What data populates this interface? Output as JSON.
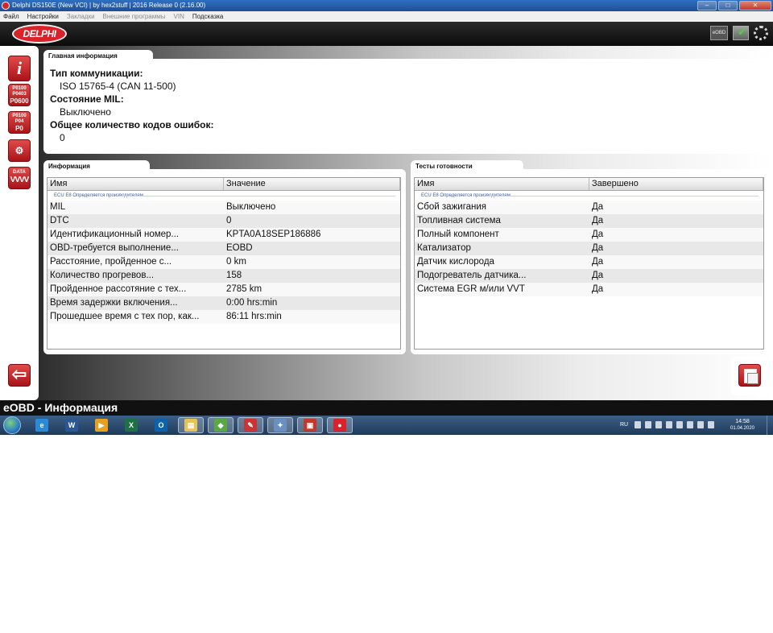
{
  "window": {
    "title": "Delphi DS150E (New VCI) | by hex2stuff | 2016 Release 0 (2.16.00)"
  },
  "menu": [
    {
      "label": "Файл",
      "enabled": true
    },
    {
      "label": "Настройки",
      "enabled": true
    },
    {
      "label": "Закладки",
      "enabled": false
    },
    {
      "label": "Внешние программы",
      "enabled": false
    },
    {
      "label": "VIN",
      "enabled": false
    },
    {
      "label": "Подсказка",
      "enabled": true
    }
  ],
  "header": {
    "logo_text": "DELPHI",
    "eobd_badge": "eOBD",
    "icons": [
      "eobd-icon",
      "flag-check-icon",
      "busy-spinner-icon"
    ]
  },
  "sidebar": {
    "info_glyph": "i",
    "codes_btn": [
      "P0100",
      "P0403",
      "P0600"
    ],
    "codes_clear_btn": [
      "P0100",
      "P04",
      "P0"
    ],
    "data_label": "DATA",
    "data_wave": "VVVV",
    "back_glyph": "⇦"
  },
  "main_info": {
    "tab": "Главная информация",
    "fields": [
      {
        "label": "Тип коммуникации:",
        "value": "ISO 15765-4 (CAN 11-500)"
      },
      {
        "label": "Состояние MIL:",
        "value": "Выключено"
      },
      {
        "label": "Общее количество кодов ошибок:",
        "value": "0"
      }
    ]
  },
  "info_panel": {
    "tab": "Информация",
    "columns": [
      "Имя",
      "Значение"
    ],
    "group": "ECU E8 Определяется производителем",
    "rows": [
      [
        "MIL",
        "Выключено"
      ],
      [
        "DTC",
        "0"
      ],
      [
        "Идентификационный номер...",
        "KPTA0A18SEP186886"
      ],
      [
        "OBD-требуется выполнение...",
        "EOBD"
      ],
      [
        "Расстояние, пройденное с...",
        "0 km"
      ],
      [
        "Количество прогревов...",
        "158"
      ],
      [
        "Пройденное рассотяние с тех...",
        "2785 km"
      ],
      [
        "Время задержки включения...",
        "0:00 hrs:min"
      ],
      [
        "Прошедшее время с тех пор, как...",
        "86:11 hrs:min"
      ]
    ]
  },
  "readiness_panel": {
    "tab": "Тесты готовности",
    "columns": [
      "Имя",
      "Завершено"
    ],
    "group": "ECU E8 Определяется производителем",
    "rows": [
      [
        "Сбой зажигания",
        "Да"
      ],
      [
        "Топливная система",
        "Да"
      ],
      [
        "Полный компонент",
        "Да"
      ],
      [
        "Катализатор",
        "Да"
      ],
      [
        "Датчик кислорода",
        "Да"
      ],
      [
        "Подогреватель датчика...",
        "Да"
      ],
      [
        "Система EGR м/или VVT",
        "Да"
      ]
    ]
  },
  "status": {
    "text": "eOBD - Информация"
  },
  "taskbar": {
    "apps": [
      {
        "name": "ie",
        "glyph": "e",
        "color": "#2a8ad8"
      },
      {
        "name": "word",
        "glyph": "W",
        "color": "#2b5797"
      },
      {
        "name": "media-player",
        "glyph": "▶",
        "color": "#e8a020"
      },
      {
        "name": "excel",
        "glyph": "X",
        "color": "#1e7145"
      },
      {
        "name": "outlook",
        "glyph": "O",
        "color": "#0a64ad"
      },
      {
        "name": "explorer",
        "glyph": "▤",
        "color": "#e6c35a"
      },
      {
        "name": "bluestacks",
        "glyph": "◆",
        "color": "#5aa844"
      },
      {
        "name": "tool",
        "glyph": "✎",
        "color": "#c33"
      },
      {
        "name": "paint",
        "glyph": "✦",
        "color": "#6a8fc2"
      },
      {
        "name": "toolbox",
        "glyph": "▣",
        "color": "#c0392b"
      },
      {
        "name": "delphi",
        "glyph": "●",
        "color": "#d8232a"
      }
    ],
    "lang": "RU",
    "time": "14:58",
    "date": "01.04.2020"
  },
  "colors": {
    "accent_red": "#d8232a",
    "panel_bg": "#ffffff",
    "status_bg": "#111111"
  }
}
